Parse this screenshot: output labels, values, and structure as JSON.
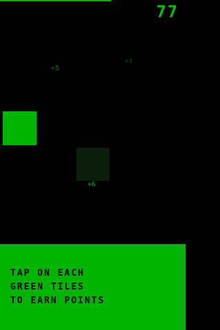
{
  "game": {
    "timer_progress": 0.6,
    "score": "77",
    "floating_points": [
      {
        "text": "+5",
        "color": "#0f7a0f"
      },
      {
        "text": "+4",
        "color": "#0c4a0c"
      },
      {
        "text": "+6",
        "color": "#1aa81a"
      }
    ]
  },
  "footer": {
    "instructions": [
      "TAP ON EACH",
      "GREEN TILES",
      "TO EARN POINTS"
    ]
  },
  "colors": {
    "background": "#000000",
    "accent_green": "#00b400",
    "faded_tile": "#0a1e0a",
    "instruction_text": "#000000"
  }
}
